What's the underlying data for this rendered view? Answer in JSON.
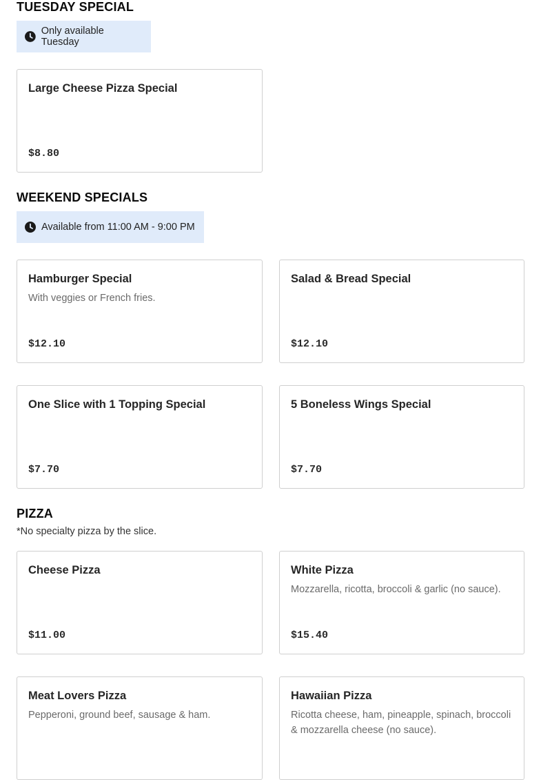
{
  "sections": [
    {
      "title": "TUESDAY SPECIAL",
      "availability": "Only available Tuesday",
      "items": [
        {
          "name": "Large Cheese Pizza Special",
          "description": "",
          "price": "$8.80"
        }
      ]
    },
    {
      "title": "WEEKEND SPECIALS",
      "availability": "Available from 11:00 AM - 9:00 PM",
      "items": [
        {
          "name": "Hamburger Special",
          "description": "With veggies or French fries.",
          "price": "$12.10"
        },
        {
          "name": "Salad & Bread Special",
          "description": "",
          "price": "$12.10"
        },
        {
          "name": "One Slice with 1 Topping Special",
          "description": "",
          "price": "$7.70"
        },
        {
          "name": "5 Boneless Wings Special",
          "description": "",
          "price": "$7.70"
        }
      ]
    },
    {
      "title": "PIZZA",
      "note": "*No specialty pizza by the slice.",
      "items": [
        {
          "name": "Cheese Pizza",
          "description": "",
          "price": "$11.00"
        },
        {
          "name": "White Pizza",
          "description": "Mozzarella, ricotta, broccoli & garlic (no sauce).",
          "price": "$15.40"
        },
        {
          "name": "Meat Lovers Pizza",
          "description": "Pepperoni, ground beef, sausage & ham.",
          "price": ""
        },
        {
          "name": "Hawaiian Pizza",
          "description": "Ricotta cheese, ham, pineapple, spinach, broccoli & mozzarella cheese (no sauce).",
          "price": ""
        }
      ]
    }
  ],
  "icons": {
    "availability": "clock-icon"
  },
  "colors": {
    "availability_bg": "#e0ebfa",
    "card_border": "#cfcfcf"
  }
}
